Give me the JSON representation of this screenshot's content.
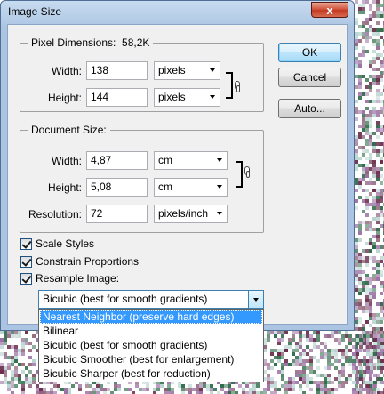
{
  "window": {
    "title": "Image Size",
    "close_glyph": "x"
  },
  "pixel_dimensions": {
    "legend": "Pixel Dimensions:",
    "size": "58,2K",
    "width_label": "Width:",
    "width_value": "138",
    "width_unit": "pixels",
    "height_label": "Height:",
    "height_value": "144",
    "height_unit": "pixels"
  },
  "document_size": {
    "legend": "Document Size:",
    "width_label": "Width:",
    "width_value": "4,87",
    "width_unit": "cm",
    "height_label": "Height:",
    "height_value": "5,08",
    "height_unit": "cm",
    "resolution_label": "Resolution:",
    "resolution_value": "72",
    "resolution_unit": "pixels/inch"
  },
  "buttons": {
    "ok": "OK",
    "cancel": "Cancel",
    "auto": "Auto..."
  },
  "options": {
    "scale_styles": {
      "label": "Scale Styles",
      "checked": true
    },
    "constrain_proportions": {
      "label": "Constrain Proportions",
      "checked": true
    },
    "resample_image": {
      "label": "Resample Image:",
      "checked": true
    }
  },
  "resample": {
    "selected": "Bicubic (best for smooth gradients)",
    "options": [
      "Nearest Neighbor (preserve hard edges)",
      "Bilinear",
      "Bicubic (best for smooth gradients)",
      "Bicubic Smoother (best for enlargement)",
      "Bicubic Sharper (best for reduction)"
    ],
    "highlighted": "Nearest Neighbor (preserve hard edges)"
  },
  "colors": {
    "titlebar": "#aac4e1",
    "close_button": "#c23a22",
    "selection": "#3399ff",
    "background_pixels": [
      "#6b2f4d",
      "#2f6b4a",
      "#9a6fa3",
      "#b9d4d0"
    ]
  }
}
